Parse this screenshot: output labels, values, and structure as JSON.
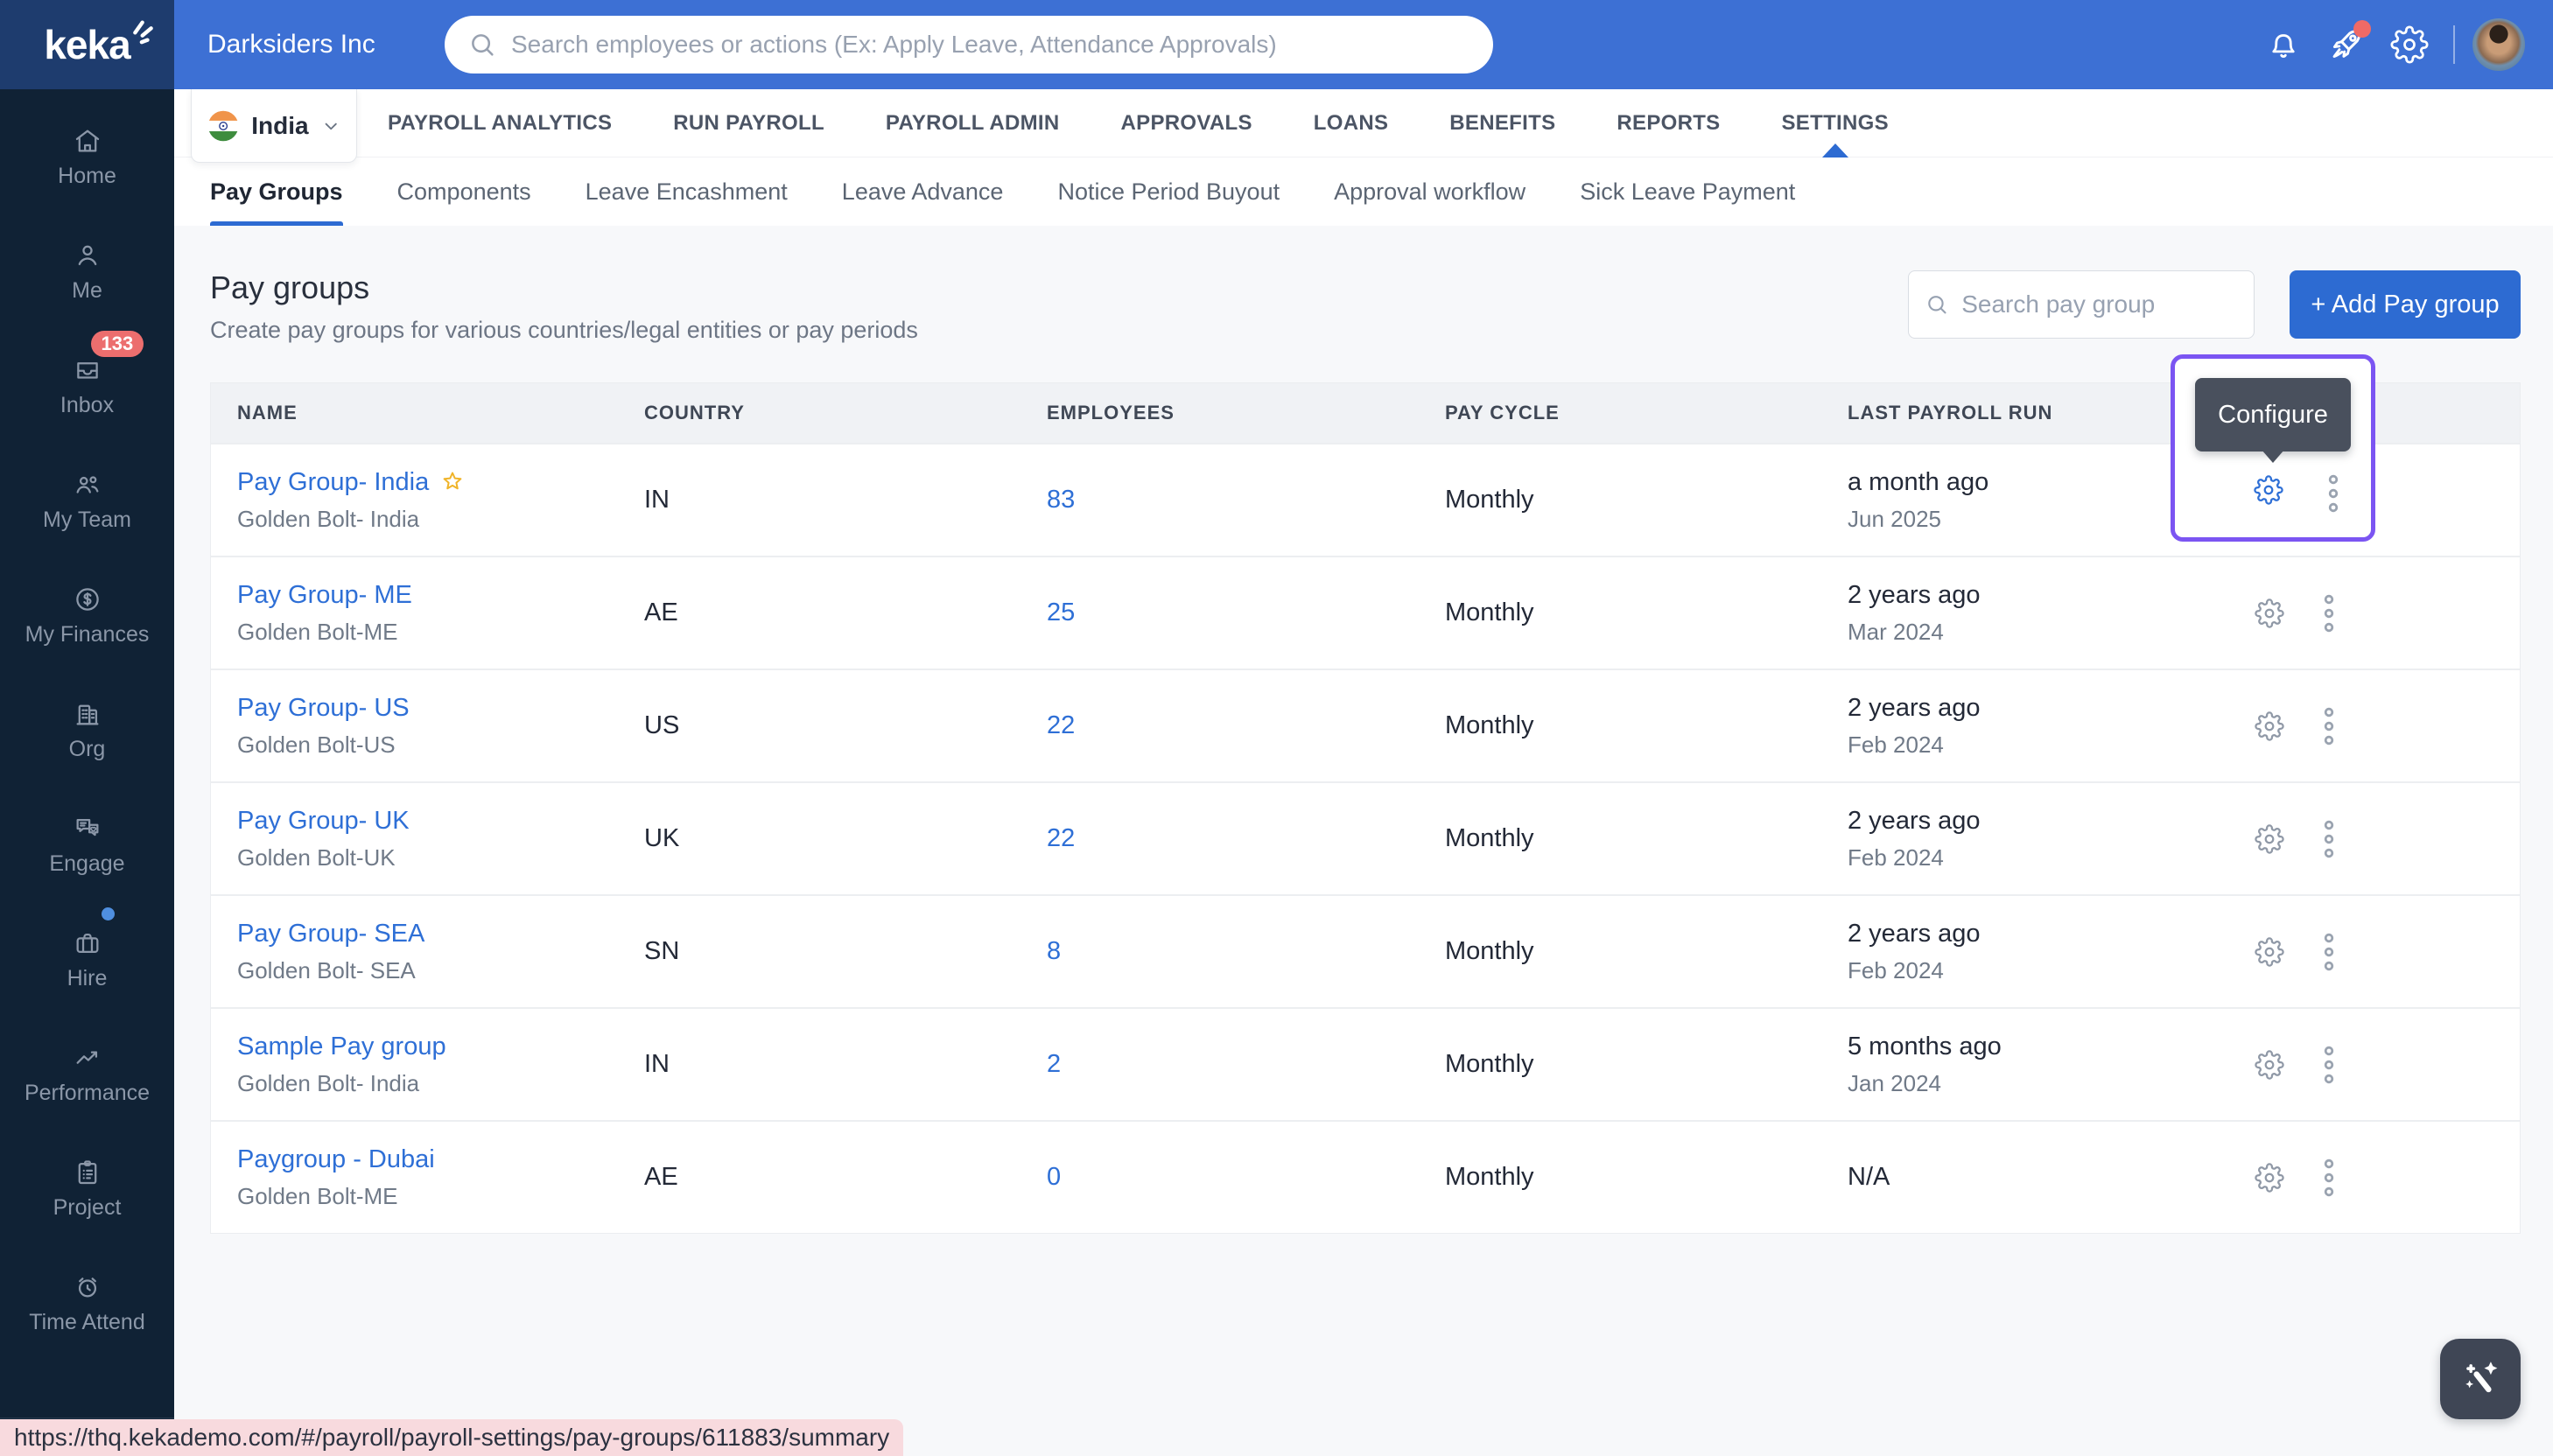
{
  "topbar": {
    "logo_text": "keka",
    "company": "Darksiders Inc",
    "search_placeholder": "Search employees or actions (Ex: Apply Leave, Attendance Approvals)"
  },
  "country_selector": {
    "label": "India"
  },
  "module_nav": {
    "items": [
      {
        "label": "PAYROLL ANALYTICS"
      },
      {
        "label": "RUN PAYROLL"
      },
      {
        "label": "PAYROLL ADMIN"
      },
      {
        "label": "APPROVALS"
      },
      {
        "label": "LOANS"
      },
      {
        "label": "BENEFITS"
      },
      {
        "label": "REPORTS"
      },
      {
        "label": "SETTINGS"
      }
    ],
    "active": "SETTINGS"
  },
  "tabs": [
    {
      "label": "Pay Groups"
    },
    {
      "label": "Components"
    },
    {
      "label": "Leave Encashment"
    },
    {
      "label": "Leave Advance"
    },
    {
      "label": "Notice Period Buyout"
    },
    {
      "label": "Approval workflow"
    },
    {
      "label": "Sick Leave Payment"
    }
  ],
  "sidebar": {
    "items": [
      {
        "label": "Home"
      },
      {
        "label": "Me"
      },
      {
        "label": "Inbox",
        "badge": "133"
      },
      {
        "label": "My Team"
      },
      {
        "label": "My Finances"
      },
      {
        "label": "Org"
      },
      {
        "label": "Engage"
      },
      {
        "label": "Hire"
      },
      {
        "label": "Performance"
      },
      {
        "label": "Project"
      },
      {
        "label": "Time Attend"
      }
    ]
  },
  "page": {
    "title": "Pay groups",
    "subtitle": "Create pay groups for various countries/legal entities or pay periods",
    "search_placeholder": "Search pay group",
    "add_button": "+ Add Pay group"
  },
  "table": {
    "headers": [
      "NAME",
      "COUNTRY",
      "EMPLOYEES",
      "PAY CYCLE",
      "LAST PAYROLL RUN"
    ],
    "rows": [
      {
        "name": "Pay Group- India",
        "entity": "Golden Bolt- India",
        "country": "IN",
        "employees": "83",
        "cycle": "Monthly",
        "last_run": "a month ago",
        "last_run_date": "Jun 2025",
        "starred": true
      },
      {
        "name": "Pay Group- ME",
        "entity": "Golden Bolt-ME",
        "country": "AE",
        "employees": "25",
        "cycle": "Monthly",
        "last_run": "2 years ago",
        "last_run_date": "Mar 2024"
      },
      {
        "name": "Pay Group- US",
        "entity": "Golden Bolt-US",
        "country": "US",
        "employees": "22",
        "cycle": "Monthly",
        "last_run": "2 years ago",
        "last_run_date": "Feb 2024"
      },
      {
        "name": "Pay Group- UK",
        "entity": "Golden Bolt-UK",
        "country": "UK",
        "employees": "22",
        "cycle": "Monthly",
        "last_run": "2 years ago",
        "last_run_date": "Feb 2024"
      },
      {
        "name": "Pay Group- SEA",
        "entity": "Golden Bolt- SEA",
        "country": "SN",
        "employees": "8",
        "cycle": "Monthly",
        "last_run": "2 years ago",
        "last_run_date": "Feb 2024"
      },
      {
        "name": "Sample Pay group",
        "entity": "Golden Bolt- India",
        "country": "IN",
        "employees": "2",
        "cycle": "Monthly",
        "last_run": "5 months ago",
        "last_run_date": "Jan 2024"
      },
      {
        "name": "Paygroup - Dubai",
        "entity": "Golden Bolt-ME",
        "country": "AE",
        "employees": "0",
        "cycle": "Monthly",
        "last_run": "N/A",
        "last_run_date": ""
      }
    ]
  },
  "tooltip": {
    "label": "Configure"
  },
  "statusbar": {
    "url": "https://thq.kekademo.com/#/payroll/payroll-settings/pay-groups/611883/summary"
  },
  "colors": {
    "header_blue": "#3d70d4",
    "logo_navy": "#1e3c6e",
    "sidebar_navy": "#102235",
    "accent_blue": "#2d6bd2",
    "highlight_purple": "#7b55f2",
    "tooltip_slate": "#49505d",
    "badge_red": "#ec6e6e",
    "status_pink": "#f8dade"
  }
}
